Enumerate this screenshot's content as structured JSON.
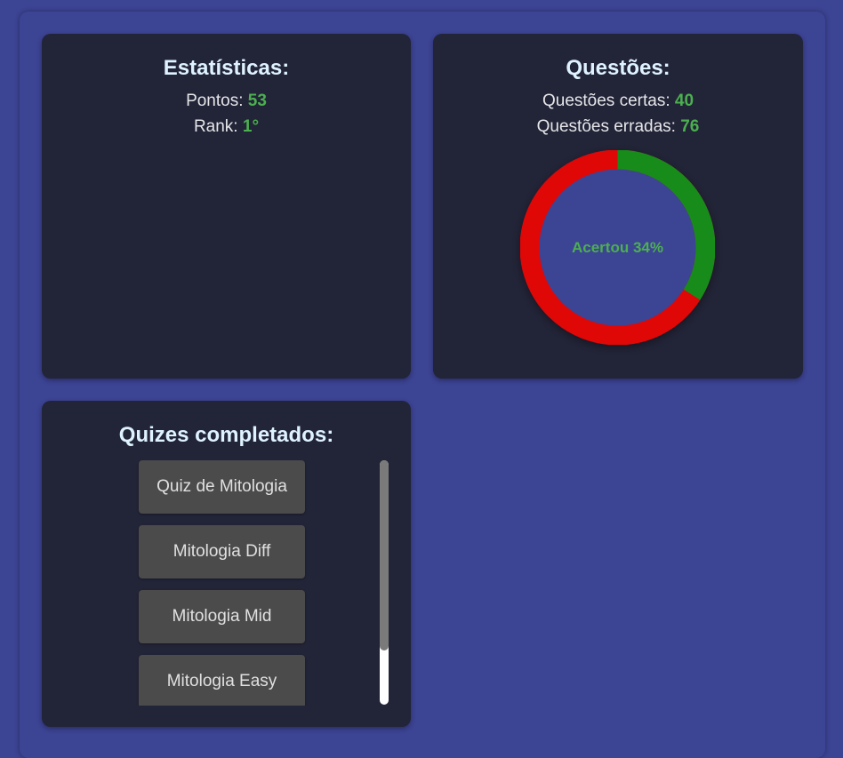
{
  "stats": {
    "title": "Estatísticas:",
    "points_label": "Pontos: ",
    "points_value": "53",
    "rank_label": "Rank: ",
    "rank_value": "1°"
  },
  "questions": {
    "title": "Questões:",
    "correct_label": "Questões certas: ",
    "correct_value": "40",
    "wrong_label": "Questões erradas: ",
    "wrong_value": "76",
    "center_label": "Acertou 34%",
    "correct_fraction": 0.34,
    "correct_color": "#178c1a",
    "wrong_color": "#e00707",
    "center_color": "#3c4494"
  },
  "quizzes": {
    "title": "Quizes completados:",
    "items": [
      {
        "label": "Quiz de Mitologia"
      },
      {
        "label": "Mitologia Diff"
      },
      {
        "label": "Mitologia Mid"
      },
      {
        "label": "Mitologia Easy"
      }
    ]
  },
  "colors": {
    "background": "#3c4494",
    "card": "#222437",
    "accent_green": "#4caf50",
    "button": "#4b4b4b"
  }
}
